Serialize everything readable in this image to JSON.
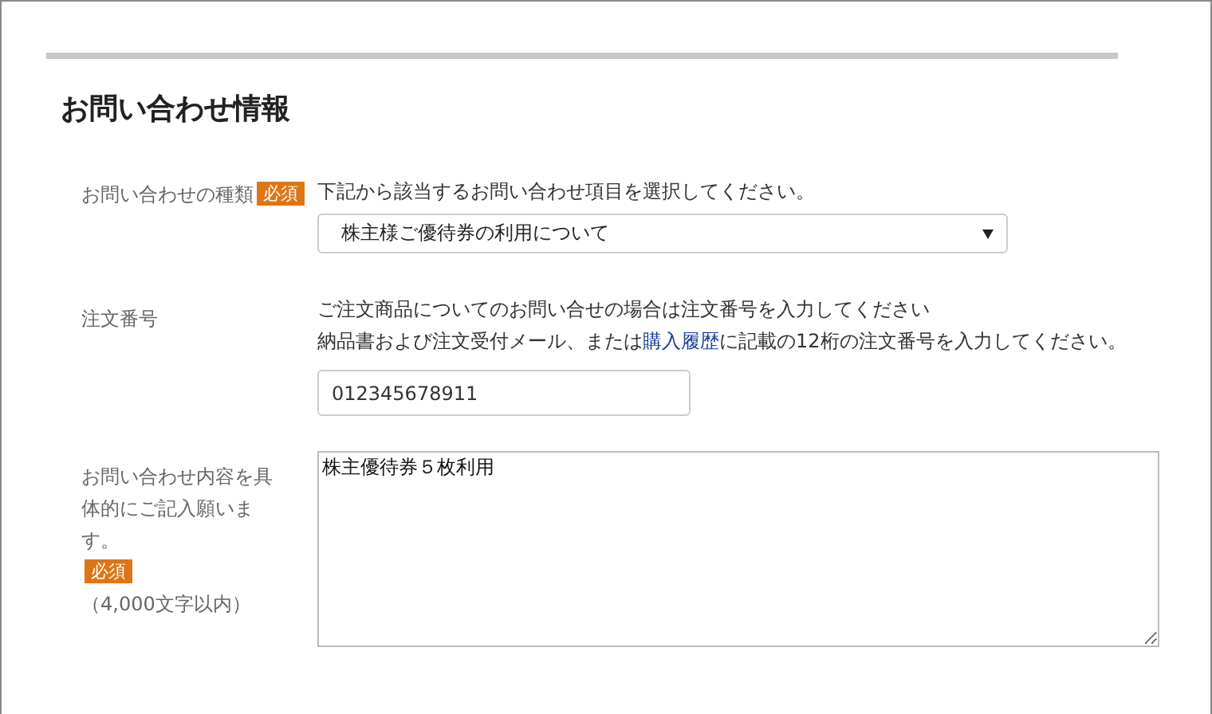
{
  "section_title": "お問い合わせ情報",
  "fields": [
    {
      "kind": "select",
      "label": "お問い合わせの種類",
      "badge": "必須",
      "notes": [
        {
          "text": "下記から該当するお問い合わせ項目を選択してください。"
        }
      ],
      "value": "株主様ご優待券の利用について"
    },
    {
      "kind": "input",
      "label": "注文番号",
      "notes": [
        {
          "text": "ご注文商品についてのお問い合せの場合は注文番号を入力してください"
        },
        {
          "text": "納品書および注文受付メール、または",
          "link": "購入履歴",
          "after": "に記載の12桁の注文番号を入力してください。"
        }
      ],
      "value": "012345678911"
    },
    {
      "kind": "textarea",
      "label": "お問い合わせ内容を具体的にご記入願います。",
      "badge": "必須",
      "sublabel": "（4,000文字以内）",
      "value": "株主優待券５枚利用"
    }
  ]
}
